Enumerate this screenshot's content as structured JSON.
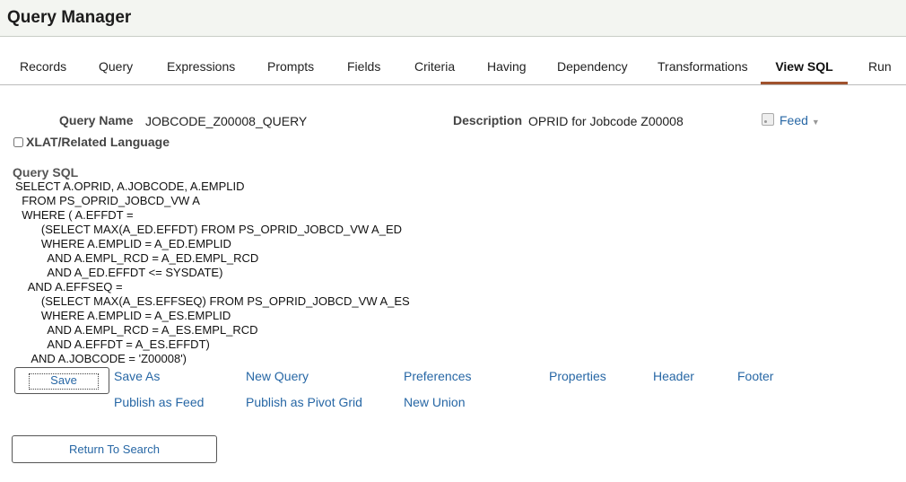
{
  "header": {
    "title": "Query Manager"
  },
  "tabs": [
    {
      "label": "Records"
    },
    {
      "label": "Query"
    },
    {
      "label": "Expressions"
    },
    {
      "label": "Prompts"
    },
    {
      "label": "Fields"
    },
    {
      "label": "Criteria"
    },
    {
      "label": "Having"
    },
    {
      "label": "Dependency"
    },
    {
      "label": "Transformations"
    },
    {
      "label": "View SQL",
      "active": true
    },
    {
      "label": "Run"
    }
  ],
  "query": {
    "name_label": "Query Name",
    "name_value": "JOBCODE_Z00008_QUERY",
    "description_label": "Description",
    "description_value": "OPRID for Jobcode Z00008",
    "feed_label": "Feed",
    "xlat_label": "XLAT/Related Language",
    "xlat_checked": false
  },
  "sql": {
    "heading": "Query SQL",
    "text": "SELECT A.OPRID, A.JOBCODE, A.EMPLID\n  FROM PS_OPRID_JOBCD_VW A\n  WHERE ( A.EFFDT =\n        (SELECT MAX(A_ED.EFFDT) FROM PS_OPRID_JOBCD_VW A_ED\n        WHERE A.EMPLID = A_ED.EMPLID\n          AND A.EMPL_RCD = A_ED.EMPL_RCD\n          AND A_ED.EFFDT <= SYSDATE)\n    AND A.EFFSEQ =\n        (SELECT MAX(A_ES.EFFSEQ) FROM PS_OPRID_JOBCD_VW A_ES\n        WHERE A.EMPLID = A_ES.EMPLID\n          AND A.EMPL_RCD = A_ES.EMPL_RCD\n          AND A.EFFDT = A_ES.EFFDT)\n     AND A.JOBCODE = 'Z00008')"
  },
  "actions": {
    "save": "Save",
    "save_as": "Save As",
    "new_query": "New Query",
    "preferences": "Preferences",
    "properties": "Properties",
    "header": "Header",
    "footer": "Footer",
    "publish_feed": "Publish as Feed",
    "publish_pivot": "Publish as Pivot Grid",
    "new_union": "New Union",
    "return_search": "Return To Search"
  }
}
